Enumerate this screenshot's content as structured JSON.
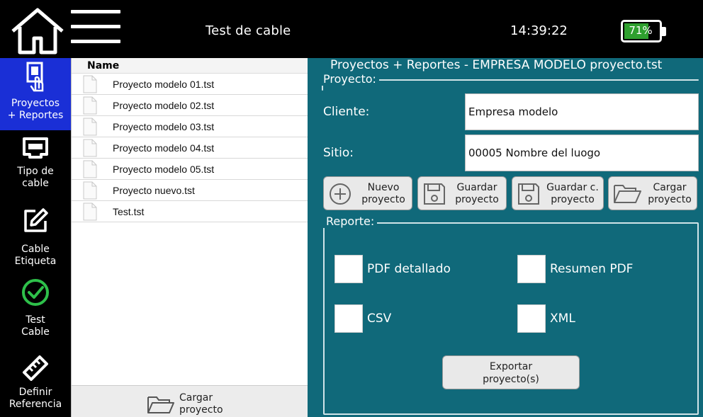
{
  "topbar": {
    "title": "Test de cable",
    "time": "14:39:22",
    "battery": {
      "percent_label": "71%",
      "level": 0.71,
      "color": "#2ea02e"
    }
  },
  "nav": {
    "items": [
      {
        "label_line1": "Proyectos",
        "label_line2": "+ Reportes",
        "icon": "report-icon",
        "active": true
      },
      {
        "label_line1": "Tipo de",
        "label_line2": "cable",
        "icon": "rj45-connector-icon",
        "active": false
      },
      {
        "label_line1": "Cable",
        "label_line2": "Etiqueta",
        "icon": "edit-pencil-icon",
        "active": false
      },
      {
        "label_line1": "Test",
        "label_line2": "Cable",
        "icon": "check-circle-icon",
        "active": false
      },
      {
        "label_line1": "Definir",
        "label_line2": "Referencia",
        "icon": "ruler-icon",
        "active": false
      }
    ],
    "active_color": "#1a2fd6"
  },
  "file_list": {
    "header": "Name",
    "files": [
      "Proyecto modelo 01.tst",
      "Proyecto modelo 02.tst",
      "Proyecto modelo 03.tst",
      "Proyecto modelo 04.tst",
      "Proyecto modelo 05.tst",
      "Proyecto nuevo.tst",
      "Test.tst"
    ],
    "footer_button": {
      "line1": "Cargar",
      "line2": "proyecto"
    }
  },
  "main": {
    "title": "Proyectos + Reportes - EMPRESA MODELO proyecto.tst",
    "bg_color": "#10697a",
    "project_group": {
      "label": "Proyecto:",
      "client_label": "Cliente:",
      "client_value": "Empresa modelo",
      "site_label": "Sitio:",
      "site_value": "00005 Nombre del luogo"
    },
    "buttons": {
      "new": {
        "line1": "Nuevo",
        "line2": "proyecto",
        "icon": "plus-circle-icon"
      },
      "save": {
        "line1": "Guardar",
        "line2": "proyecto",
        "icon": "floppy-disk-icon"
      },
      "save_as": {
        "line1": "Guardar c.",
        "line2": "proyecto",
        "icon": "floppy-disk-icon"
      },
      "load": {
        "line1": "Cargar",
        "line2": "proyecto",
        "icon": "folder-open-icon"
      }
    },
    "report_group": {
      "label": "Reporte:",
      "pdf_detailed": "PDF detallado",
      "pdf_summary": "Resumen PDF",
      "csv": "CSV",
      "xml": "XML",
      "export": {
        "line1": "Exportar",
        "line2": "proyecto(s)"
      }
    }
  }
}
